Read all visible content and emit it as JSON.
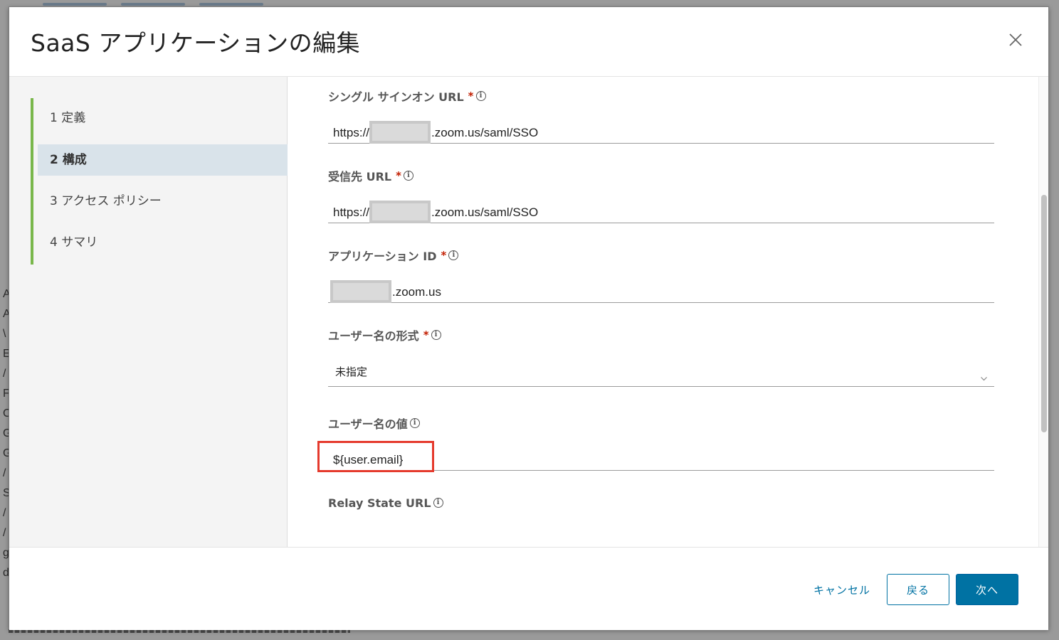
{
  "modal": {
    "title": "SaaS アプリケーションの編集"
  },
  "steps": [
    {
      "label": "1 定義"
    },
    {
      "label": "2 構成"
    },
    {
      "label": "3 アクセス ポリシー"
    },
    {
      "label": "4 サマリ"
    }
  ],
  "fields": {
    "sso_url": {
      "label": "シングル サインオン URL",
      "required": "*",
      "prefix": "https://",
      "suffix": ".zoom.us/saml/SSO"
    },
    "recipient_url": {
      "label": "受信先 URL",
      "required": "*",
      "prefix": "https://",
      "suffix": ".zoom.us/saml/SSO"
    },
    "application_id": {
      "label": "アプリケーション ID",
      "required": "*",
      "suffix": ".zoom.us"
    },
    "username_format": {
      "label": "ユーザー名の形式",
      "required": "*",
      "value": "未指定"
    },
    "username_value": {
      "label": "ユーザー名の値",
      "value": "${user.email}"
    },
    "relay_state_url": {
      "label": "Relay State URL",
      "value": ""
    }
  },
  "footer": {
    "cancel_label": "キャンセル",
    "back_label": "戻る",
    "next_label": "次へ"
  },
  "colors": {
    "accent": "#0072a3",
    "required": "#c21d00",
    "step_rail": "#79b74b",
    "highlight": "#e53a2d"
  }
}
